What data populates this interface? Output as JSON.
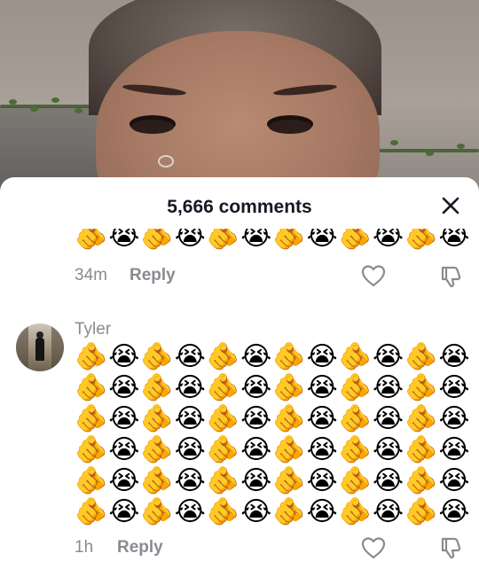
{
  "comments_panel": {
    "title": "5,666 comments",
    "close_icon": "close-icon"
  },
  "comments": [
    {
      "username": "",
      "time": "34m",
      "reply_label": "Reply",
      "emoji_pattern": [
        "🫵",
        "😭"
      ],
      "emoji_rows": 1
    },
    {
      "username": "Tyler",
      "time": "1h",
      "reply_label": "Reply",
      "emoji_pattern": [
        "🫵",
        "😭"
      ],
      "emoji_rows": 6
    }
  ],
  "icons": {
    "like": "heart-outline-icon",
    "dislike": "thumbs-down-outline-icon"
  }
}
